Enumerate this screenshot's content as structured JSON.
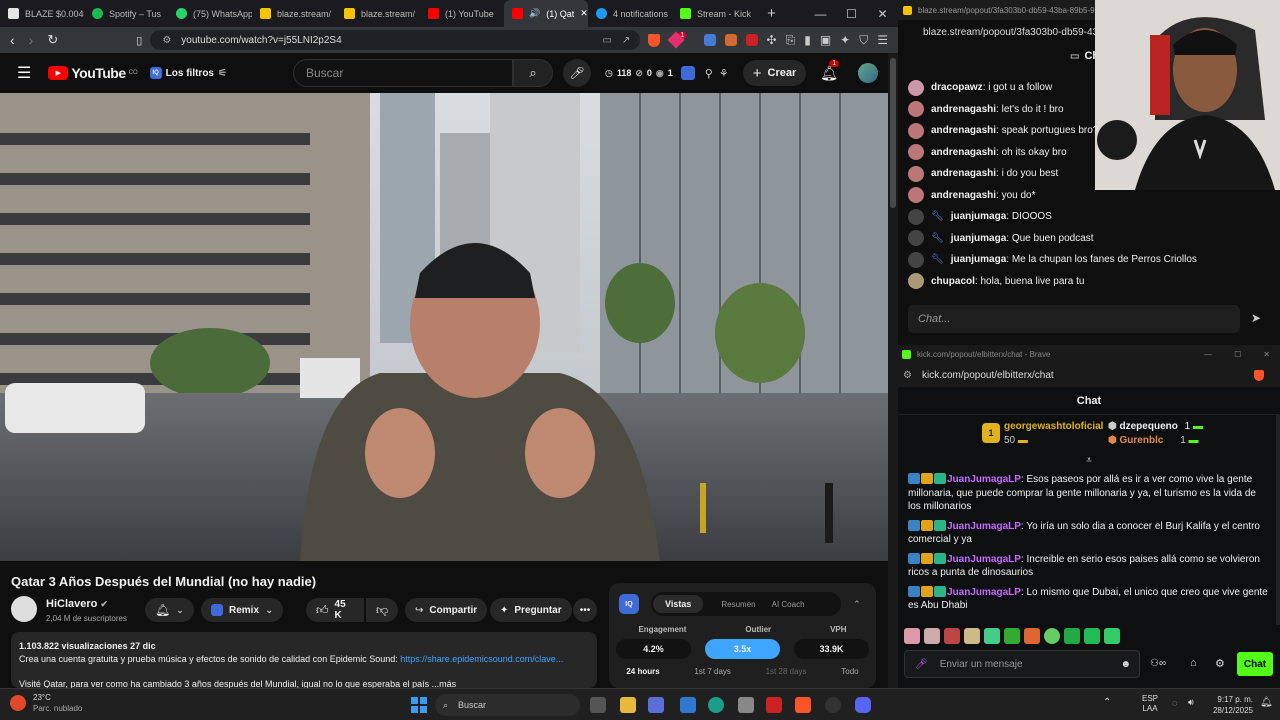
{
  "browser": {
    "tabs": [
      {
        "label": "BLAZE $0.004€",
        "color": "#e6e6e6"
      },
      {
        "label": "Spotify – Tus",
        "color": "#1db954"
      },
      {
        "label": "(75) WhatsApp",
        "color": "#25d366"
      },
      {
        "label": "blaze.stream/",
        "color": "#f5c400"
      },
      {
        "label": "blaze.stream/",
        "color": "#f5c400"
      },
      {
        "label": "(1) YouTube",
        "color": "#ff0000"
      },
      {
        "label": "(1) Qat",
        "color": "#ff0000"
      },
      {
        "label": "4 notifications",
        "color": "#1d9bf0"
      },
      {
        "label": "Stream - Kick",
        "color": "#53fc18"
      }
    ],
    "new_tab": "+",
    "url": "youtube.com/watch?v=j55LNI2p2S4",
    "brave_badge": "1"
  },
  "youtube": {
    "logo_text": "YouTube",
    "logo_sup": "CO",
    "filter_label": "Los filtros",
    "search_placeholder": "Buscar",
    "stat_clock": "118",
    "stat_a": "0",
    "stat_b": "1",
    "create_label": "Crear",
    "notif_badge": "1",
    "video_title": "Qatar 3 Años Después del Mundial (no hay nadie)",
    "channel_name": "HiClavero",
    "subscribers": "2,04 M de suscriptores",
    "remix_label": "Remix",
    "likes": "45 K",
    "share_label": "Compartir",
    "ask_label": "Preguntar",
    "views_date": "1.103.822 visualizaciones  27 dic",
    "desc_line1": "Crea una cuenta gratuita y prueba música y efectos de sonido de calidad con Epidemic Sound: ",
    "desc_link": "https://share.epidemicsound.com/clave...",
    "desc_line2": "Visité Qatar, para ver como ha cambiado 3 años después del Mundial, igual no lo que esperaba el país ...más",
    "iq": {
      "tabs": [
        "Vistas",
        "Resumen",
        "AI Coach"
      ],
      "metrics": [
        {
          "label": "Engagement",
          "value": "4.2%"
        },
        {
          "label": "Outlier",
          "value": "3.5x"
        },
        {
          "label": "VPH",
          "value": "33.9K"
        }
      ],
      "ranges": [
        "24 hours",
        "1st 7 days",
        "1st 28 days",
        "Todo"
      ]
    }
  },
  "blaze_chat": {
    "url": "blaze.stream/popout/3fa303b0-db59-43ba-89b5-9",
    "title": "Ch",
    "messages": [
      {
        "user": "dracopawz",
        "text": "i got u a follow",
        "color": "#c9a",
        "verified": false
      },
      {
        "user": "andrenagashi",
        "text": "let's do it ! bro",
        "color": "#b77",
        "verified": false
      },
      {
        "user": "andrenagashi",
        "text": "speak portugues bro?",
        "color": "#b77",
        "verified": false
      },
      {
        "user": "andrenagashi",
        "text": "oh its okay bro",
        "color": "#b77",
        "verified": false
      },
      {
        "user": "andrenagashi",
        "text": "i do you best",
        "color": "#b77",
        "verified": false
      },
      {
        "user": "andrenagashi",
        "text": "you do*",
        "color": "#b77",
        "verified": false
      },
      {
        "user": "juanjumaga",
        "text": "DIOOOS",
        "color": "#555",
        "verified": true
      },
      {
        "user": "juanjumaga",
        "text": "Que buen podcast",
        "color": "#555",
        "verified": true
      },
      {
        "user": "juanjumaga",
        "text": "Me la chupan los fanes de Perros Criollos",
        "color": "#555",
        "verified": true
      },
      {
        "user": "chupacol",
        "text": "hola, buena live para tu",
        "color": "#a97",
        "verified": false
      }
    ],
    "input_placeholder": "Chat..."
  },
  "kick_chat": {
    "window_title": "kick.com/popout/elbitterx/chat - Brave",
    "url": "kick.com/popout/elbitterx/chat",
    "header": "Chat",
    "gifters": [
      {
        "rank": "1",
        "name": "georgewashtoloficial",
        "amount": "50"
      },
      {
        "name": "dzepequeno",
        "amount": "1"
      },
      {
        "name": "Gurenblc",
        "amount": "1"
      }
    ],
    "messages": [
      {
        "user": "JuanJumagaLP",
        "text": "Esos paseos por allá es ir a ver como vive la gente millonaria, que puede comprar la gente millonaria y ya, el turismo es la vida de los millonarios"
      },
      {
        "user": "JuanJumagaLP",
        "text": "Yo iría un solo dia a conocer el Burj Kalifa y el centro comercial y ya"
      },
      {
        "user": "JuanJumagaLP",
        "text": "Increible en serio esos paises allá como se volvieron ricos a punta de dinosaurios"
      },
      {
        "user": "JuanJumagaLP",
        "text": "Lo mismo que Dubai, el unico que creo que vive gente es Abu Dhabi"
      }
    ],
    "input_placeholder": "Enviar un mensaje",
    "send_label": "Chat"
  },
  "taskbar": {
    "temp": "23°C",
    "weather": "Parc. nublado",
    "search": "Buscar",
    "lang1": "ESP",
    "lang2": "LAA",
    "time": "9:17 p. m.",
    "date": "28/12/2025"
  },
  "colors": {
    "accent_green": "#53fc18",
    "kick_user": "#c56bff",
    "yt_red": "#ff0000",
    "iq_blue": "#3ea6ff"
  }
}
